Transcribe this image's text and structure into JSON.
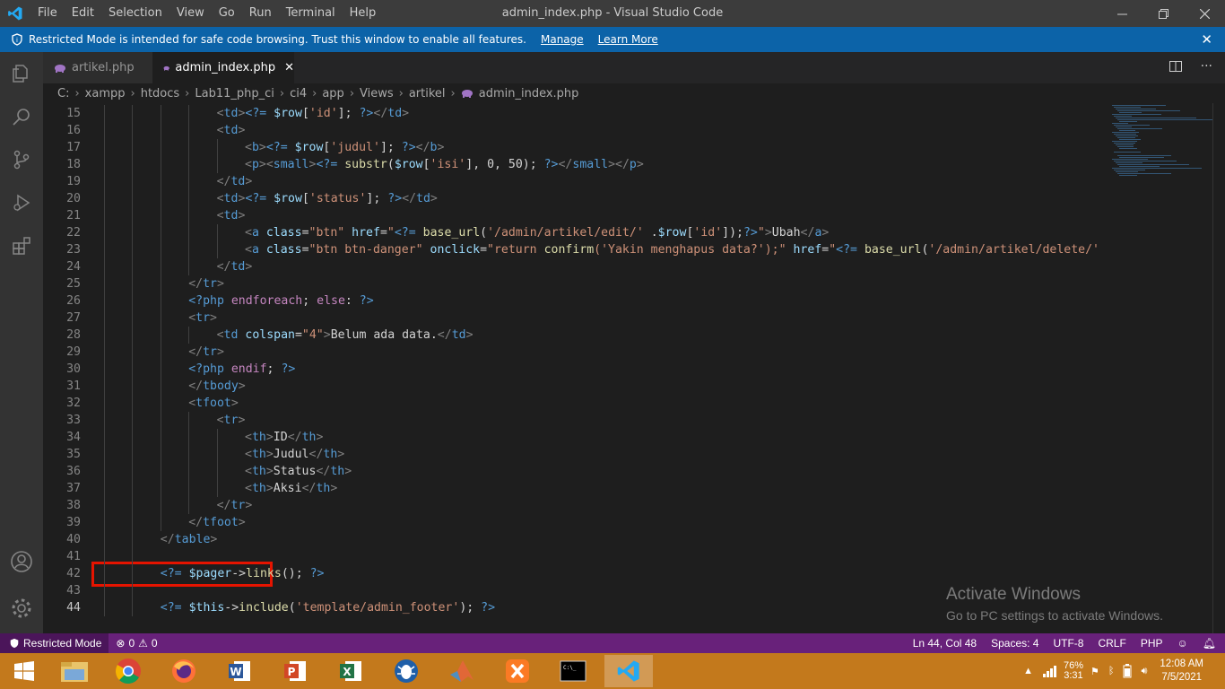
{
  "titlebar": {
    "menu": [
      "File",
      "Edit",
      "Selection",
      "View",
      "Go",
      "Run",
      "Terminal",
      "Help"
    ],
    "title": "admin_index.php - Visual Studio Code"
  },
  "banner": {
    "text": "Restricted Mode is intended for safe code browsing. Trust this window to enable all features.",
    "manage": "Manage",
    "learn_more": "Learn More"
  },
  "tabs": [
    {
      "label": "artikel.php"
    },
    {
      "label": "admin_index.php"
    }
  ],
  "breadcrumb": [
    "C:",
    "xampp",
    "htdocs",
    "Lab11_php_ci",
    "ci4",
    "app",
    "Views",
    "artikel",
    "admin_index.php"
  ],
  "editor": {
    "lines": [
      {
        "n": "15",
        "html": "<span class=\"tg\">&lt;</span><span class=\"t\">td</span><span class=\"tg\">&gt;</span><span class=\"t\">&lt;?=</span> <span class=\"v\">$row</span>[<span class=\"s\">'id'</span>]; <span class=\"t\">?&gt;</span><span class=\"tg\">&lt;/</span><span class=\"t\">td</span><span class=\"tg\">&gt;</span>",
        "indent": 4
      },
      {
        "n": "16",
        "html": "<span class=\"tg\">&lt;</span><span class=\"t\">td</span><span class=\"tg\">&gt;</span>",
        "indent": 4
      },
      {
        "n": "17",
        "html": "<span class=\"tg\">&lt;</span><span class=\"t\">b</span><span class=\"tg\">&gt;</span><span class=\"t\">&lt;?=</span> <span class=\"v\">$row</span>[<span class=\"s\">'judul'</span>]; <span class=\"t\">?&gt;</span><span class=\"tg\">&lt;/</span><span class=\"t\">b</span><span class=\"tg\">&gt;</span>",
        "indent": 5
      },
      {
        "n": "18",
        "html": "<span class=\"tg\">&lt;</span><span class=\"t\">p</span><span class=\"tg\">&gt;&lt;</span><span class=\"t\">small</span><span class=\"tg\">&gt;</span><span class=\"t\">&lt;?=</span> <span class=\"f\">substr</span>(<span class=\"v\">$row</span>[<span class=\"s\">'isi'</span>], 0, 50); <span class=\"t\">?&gt;</span><span class=\"tg\">&lt;/</span><span class=\"t\">small</span><span class=\"tg\">&gt;&lt;/</span><span class=\"t\">p</span><span class=\"tg\">&gt;</span>",
        "indent": 5
      },
      {
        "n": "19",
        "html": "<span class=\"tg\">&lt;/</span><span class=\"t\">td</span><span class=\"tg\">&gt;</span>",
        "indent": 4
      },
      {
        "n": "20",
        "html": "<span class=\"tg\">&lt;</span><span class=\"t\">td</span><span class=\"tg\">&gt;</span><span class=\"t\">&lt;?=</span> <span class=\"v\">$row</span>[<span class=\"s\">'status'</span>]; <span class=\"t\">?&gt;</span><span class=\"tg\">&lt;/</span><span class=\"t\">td</span><span class=\"tg\">&gt;</span>",
        "indent": 4
      },
      {
        "n": "21",
        "html": "<span class=\"tg\">&lt;</span><span class=\"t\">td</span><span class=\"tg\">&gt;</span>",
        "indent": 4
      },
      {
        "n": "22",
        "html": "<span class=\"tg\">&lt;</span><span class=\"t\">a</span> <span class=\"a\">class</span>=<span class=\"s\">\"btn\"</span> <span class=\"a\">href</span>=<span class=\"s\">\"</span><span class=\"t\">&lt;?=</span> <span class=\"f\">base_url</span>(<span class=\"s\">'/admin/artikel/edit/'</span> .<span class=\"v\">$row</span>[<span class=\"s\">'id'</span>]);<span class=\"t\">?&gt;</span><span class=\"s\">\"</span><span class=\"tg\">&gt;</span>Ubah<span class=\"tg\">&lt;/</span><span class=\"t\">a</span><span class=\"tg\">&gt;</span>",
        "indent": 5
      },
      {
        "n": "23",
        "html": "<span class=\"tg\">&lt;</span><span class=\"t\">a</span> <span class=\"a\">class</span>=<span class=\"s\">\"btn btn-danger\"</span> <span class=\"a\">onclick</span>=<span class=\"s\">\"return </span><span class=\"f\">confirm</span><span class=\"s\">('Yakin menghapus data?');\"</span> <span class=\"a\">href</span>=<span class=\"s\">\"</span><span class=\"t\">&lt;?=</span> <span class=\"f\">base_url</span>(<span class=\"s\">'/admin/artikel/delete/'</span> .<span class=\"v\">$row</span>[<span class=\"s\">'id'</span>])",
        "indent": 5
      },
      {
        "n": "24",
        "html": "<span class=\"tg\">&lt;/</span><span class=\"t\">td</span><span class=\"tg\">&gt;</span>",
        "indent": 4
      },
      {
        "n": "25",
        "html": "<span class=\"tg\">&lt;/</span><span class=\"t\">tr</span><span class=\"tg\">&gt;</span>",
        "indent": 3
      },
      {
        "n": "26",
        "html": "<span class=\"t\">&lt;?php</span> <span class=\"k\">endforeach</span>; <span class=\"k\">else</span>: <span class=\"t\">?&gt;</span>",
        "indent": 3
      },
      {
        "n": "27",
        "html": "<span class=\"tg\">&lt;</span><span class=\"t\">tr</span><span class=\"tg\">&gt;</span>",
        "indent": 3
      },
      {
        "n": "28",
        "html": "<span class=\"tg\">&lt;</span><span class=\"t\">td</span> <span class=\"a\">colspan</span>=<span class=\"s\">\"4\"</span><span class=\"tg\">&gt;</span>Belum ada data.<span class=\"tg\">&lt;/</span><span class=\"t\">td</span><span class=\"tg\">&gt;</span>",
        "indent": 4
      },
      {
        "n": "29",
        "html": "<span class=\"tg\">&lt;/</span><span class=\"t\">tr</span><span class=\"tg\">&gt;</span>",
        "indent": 3
      },
      {
        "n": "30",
        "html": "<span class=\"t\">&lt;?php</span> <span class=\"k\">endif</span>; <span class=\"t\">?&gt;</span>",
        "indent": 3
      },
      {
        "n": "31",
        "html": "<span class=\"tg\">&lt;/</span><span class=\"t\">tbody</span><span class=\"tg\">&gt;</span>",
        "indent": 3
      },
      {
        "n": "32",
        "html": "<span class=\"tg\">&lt;</span><span class=\"t\">tfoot</span><span class=\"tg\">&gt;</span>",
        "indent": 3
      },
      {
        "n": "33",
        "html": "<span class=\"tg\">&lt;</span><span class=\"t\">tr</span><span class=\"tg\">&gt;</span>",
        "indent": 4
      },
      {
        "n": "34",
        "html": "<span class=\"tg\">&lt;</span><span class=\"t\">th</span><span class=\"tg\">&gt;</span>ID<span class=\"tg\">&lt;/</span><span class=\"t\">th</span><span class=\"tg\">&gt;</span>",
        "indent": 5
      },
      {
        "n": "35",
        "html": "<span class=\"tg\">&lt;</span><span class=\"t\">th</span><span class=\"tg\">&gt;</span>Judul<span class=\"tg\">&lt;/</span><span class=\"t\">th</span><span class=\"tg\">&gt;</span>",
        "indent": 5
      },
      {
        "n": "36",
        "html": "<span class=\"tg\">&lt;</span><span class=\"t\">th</span><span class=\"tg\">&gt;</span>Status<span class=\"tg\">&lt;/</span><span class=\"t\">th</span><span class=\"tg\">&gt;</span>",
        "indent": 5
      },
      {
        "n": "37",
        "html": "<span class=\"tg\">&lt;</span><span class=\"t\">th</span><span class=\"tg\">&gt;</span>Aksi<span class=\"tg\">&lt;/</span><span class=\"t\">th</span><span class=\"tg\">&gt;</span>",
        "indent": 5
      },
      {
        "n": "38",
        "html": "<span class=\"tg\">&lt;/</span><span class=\"t\">tr</span><span class=\"tg\">&gt;</span>",
        "indent": 4
      },
      {
        "n": "39",
        "html": "<span class=\"tg\">&lt;/</span><span class=\"t\">tfoot</span><span class=\"tg\">&gt;</span>",
        "indent": 3
      },
      {
        "n": "40",
        "html": "<span class=\"tg\">&lt;/</span><span class=\"t\">table</span><span class=\"tg\">&gt;</span>",
        "indent": 2
      },
      {
        "n": "41",
        "html": "",
        "indent": 2
      },
      {
        "n": "42",
        "html": "<span class=\"t\">&lt;?=</span> <span class=\"v\">$pager</span>-&gt;<span class=\"f\">links</span>(); <span class=\"t\">?&gt;</span>",
        "indent": 2
      },
      {
        "n": "43",
        "html": "",
        "indent": 2
      },
      {
        "n": "44",
        "html": "<span class=\"t\">&lt;?=</span> <span class=\"v\">$this</span>-&gt;<span class=\"f\">include</span>(<span class=\"s\">'template/admin_footer'</span>); <span class=\"t\">?&gt;</span>",
        "indent": 2,
        "current": true
      }
    ]
  },
  "watermark": {
    "title": "Activate Windows",
    "subtitle": "Go to PC settings to activate Windows."
  },
  "statusbar": {
    "restricted": "Restricted Mode",
    "errors": "0",
    "warnings": "0",
    "position": "Ln 44, Col 48",
    "spaces": "Spaces: 4",
    "encoding": "UTF-8",
    "eol": "CRLF",
    "language": "PHP"
  },
  "taskbar": {
    "battery_percent": "76%",
    "battery_time": "3:31",
    "time": "12:08 AM",
    "date": "7/5/2021"
  },
  "colors": {
    "statusbar": "#68217a",
    "banner": "#0c63a8",
    "taskbar": "#c3791c",
    "highlight": "#e51400"
  }
}
